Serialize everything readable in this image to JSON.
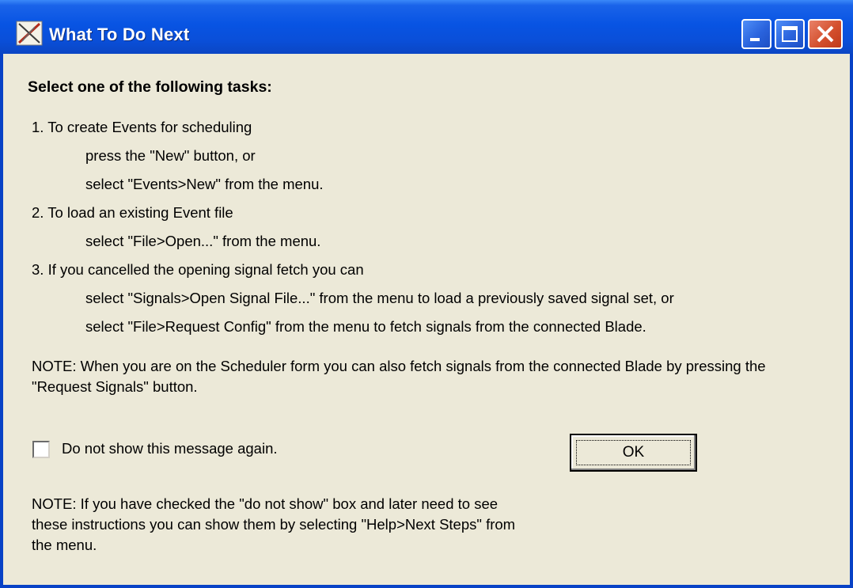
{
  "window": {
    "title": "What To Do Next",
    "icon": "scheduler-app-icon",
    "controls": [
      "minimize-icon",
      "maximize-icon",
      "close-icon"
    ]
  },
  "content": {
    "heading": "Select one of the following tasks:",
    "tasks": [
      {
        "title": "1.  To create Events for scheduling",
        "steps": [
          "press the \"New\" button, or",
          "select \"Events>New\" from the menu."
        ]
      },
      {
        "title": "2.  To load an existing Event file",
        "steps": [
          "select \"File>Open...\" from the menu."
        ]
      },
      {
        "title": "3.  If you cancelled the opening signal fetch you can",
        "steps": [
          "select \"Signals>Open Signal File...\" from the menu to load a previously saved signal set, or",
          "select \"File>Request Config\" from the menu to fetch signals from the connected Blade."
        ]
      }
    ],
    "note1": "NOTE:  When you are on the Scheduler form you can also fetch signals from the connected Blade by pressing the \"Request Signals\" button.",
    "checkbox_label": "Do not show this message again.",
    "checkbox_checked": false,
    "ok_label": "OK",
    "note2": "NOTE:  If you have checked the \"do not show\" box and later need to see these instructions you can show them by selecting \"Help>Next Steps\" from the menu."
  },
  "colors": {
    "titlebar": "#0a54e3",
    "dialog_bg": "#ece9d8",
    "close_button": "#d4502e"
  }
}
